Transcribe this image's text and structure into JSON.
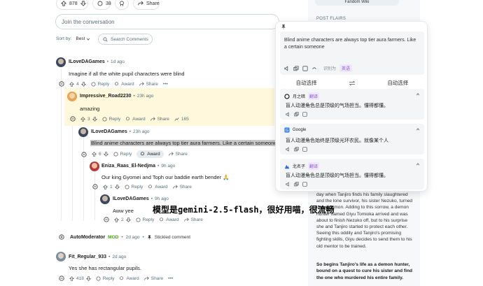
{
  "top_actions": {
    "upvotes": "878",
    "comments": "38",
    "share": "Share"
  },
  "join_conversation": "Join the conversation",
  "sort": {
    "label": "Sort by:",
    "value": "Best"
  },
  "search_comments": "Search Comments",
  "comments": [
    {
      "user": "ILoveDAGames",
      "time": "1d ago",
      "text": "Imagine if all the white pupil characters were blind",
      "votes": "4",
      "reply": "Reply",
      "award": "Award",
      "share": "Share"
    },
    {
      "user": "Impressive_Road2230",
      "time": "23h ago",
      "text": "amazing",
      "votes": "3",
      "reply": "Reply",
      "award": "Award",
      "share": "Share",
      "extra": "165"
    },
    {
      "user": "ILoveDAGames",
      "time": "23h ago",
      "text": "Blind anime characters are always top tier aura farmers. Like a certain someone",
      "votes": "6",
      "reply": "Reply",
      "award": "Award",
      "share": "Share"
    },
    {
      "user": "Eniza_Raas_El-Nedjma",
      "time": "9h ago",
      "text": "Our king Gyomei and Toph our baddie earth bender 🙏",
      "votes": "1",
      "reply": "Reply",
      "award": "Award",
      "share": "Share"
    },
    {
      "user": "ILoveDAGames",
      "time": "9h ago",
      "text": "Aww yee",
      "votes": "2",
      "reply": "Reply",
      "award": "Award",
      "share": "Share"
    }
  ],
  "automod": {
    "user": "AutoModerator",
    "mod": "MOD",
    "time": "2d ago",
    "stickied": "Stickied comment"
  },
  "comment_fit": {
    "user": "Fit_Regular_933",
    "time": "2d ago",
    "text": "Yes she has rectangular pupils.",
    "votes": "418",
    "reply": "Reply",
    "award": "Award",
    "share": "Share"
  },
  "sidebar": {
    "top_link": "Fandom Wiki",
    "post_flairs": "POST FLAIRS",
    "paragraph": "day when Tanjiro finds his family slaughtered and the lone survivor, his sister Nezuko, turned into a demon. Adding to this sorrow, a demon hunter named Giyu Tomioka arrived and was about to finish Nezuko off, but to his surprise she and Tanjiro started to protect each other. Seeing this oddity and Tanjiro's promising fighting skills, Giyu decides to send them to his old mentor to be trained.",
    "bold_paragraph": "So begins Tanjiro's life as a demon hunter, bound on a quest to cure his sister and find the one who murdered his entire family."
  },
  "translator": {
    "source_text": "Blind anime characters are always top tier aura farmers. Like a certain someone",
    "ocr_label": "识别为",
    "lang_tag": "英语",
    "source_lang": "自动选择",
    "target_lang": "自动选择",
    "results": [
      {
        "engine": "月之暗",
        "badge": "翻译",
        "text": "盲人动漫角色总是顶级的气场担当。懂得都懂。"
      },
      {
        "engine": "Google",
        "badge": "",
        "text": "盲人动漫角色始终是顶级光环农民。就像某个人"
      },
      {
        "engine": "北名子",
        "badge": "翻译",
        "text": "盲人动漫角色总是顶级的气场担当。懂得都懂。"
      }
    ]
  },
  "overlay_caption": "模型是gemini-2.5-flash，很好用喵，很流畅",
  "colors": {
    "highlight": "#fff8dc",
    "selection": "#c8c8c8",
    "automod_green": "#46a508",
    "accent": "#0079d3"
  }
}
